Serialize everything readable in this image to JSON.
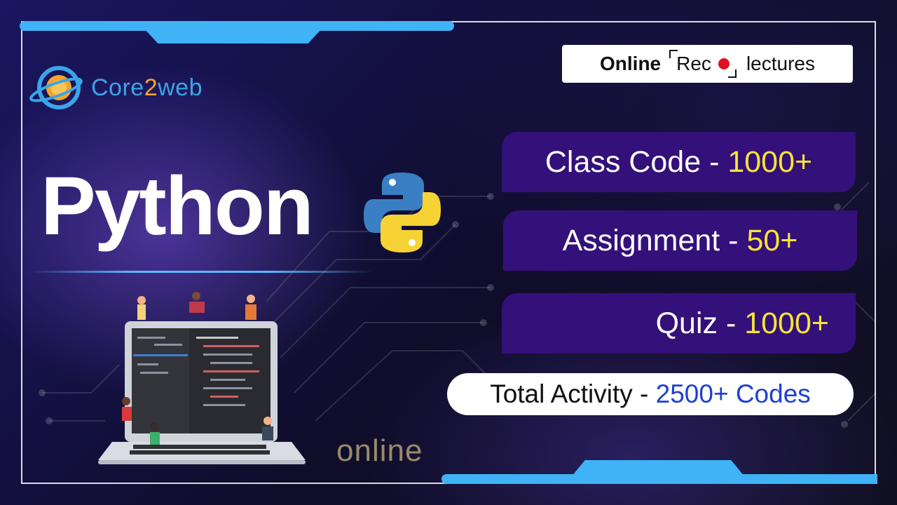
{
  "brand": {
    "name_part1": "Core",
    "name_accent": "2",
    "name_part2": "web"
  },
  "badge": {
    "bold": "Online",
    "rec": "Rec",
    "tail": "lectures"
  },
  "headline": "Python",
  "stats": [
    {
      "label": "Class Code - ",
      "value": "1000+"
    },
    {
      "label": "Assignment - ",
      "value": "50+"
    },
    {
      "label": "Quiz - ",
      "value": "1000+"
    }
  ],
  "total": {
    "label": "Total Activity - ",
    "value": "2500+ Codes"
  },
  "footer_word": "online",
  "colors": {
    "accent_blue": "#3fb3f6",
    "stat_bg": "#34107a",
    "stat_value": "#f8e33a",
    "total_value": "#1d3fd6",
    "rec_dot": "#e01020"
  },
  "icons": [
    "core2web-logo-icon",
    "python-logo-icon",
    "laptop-people-illustration"
  ]
}
